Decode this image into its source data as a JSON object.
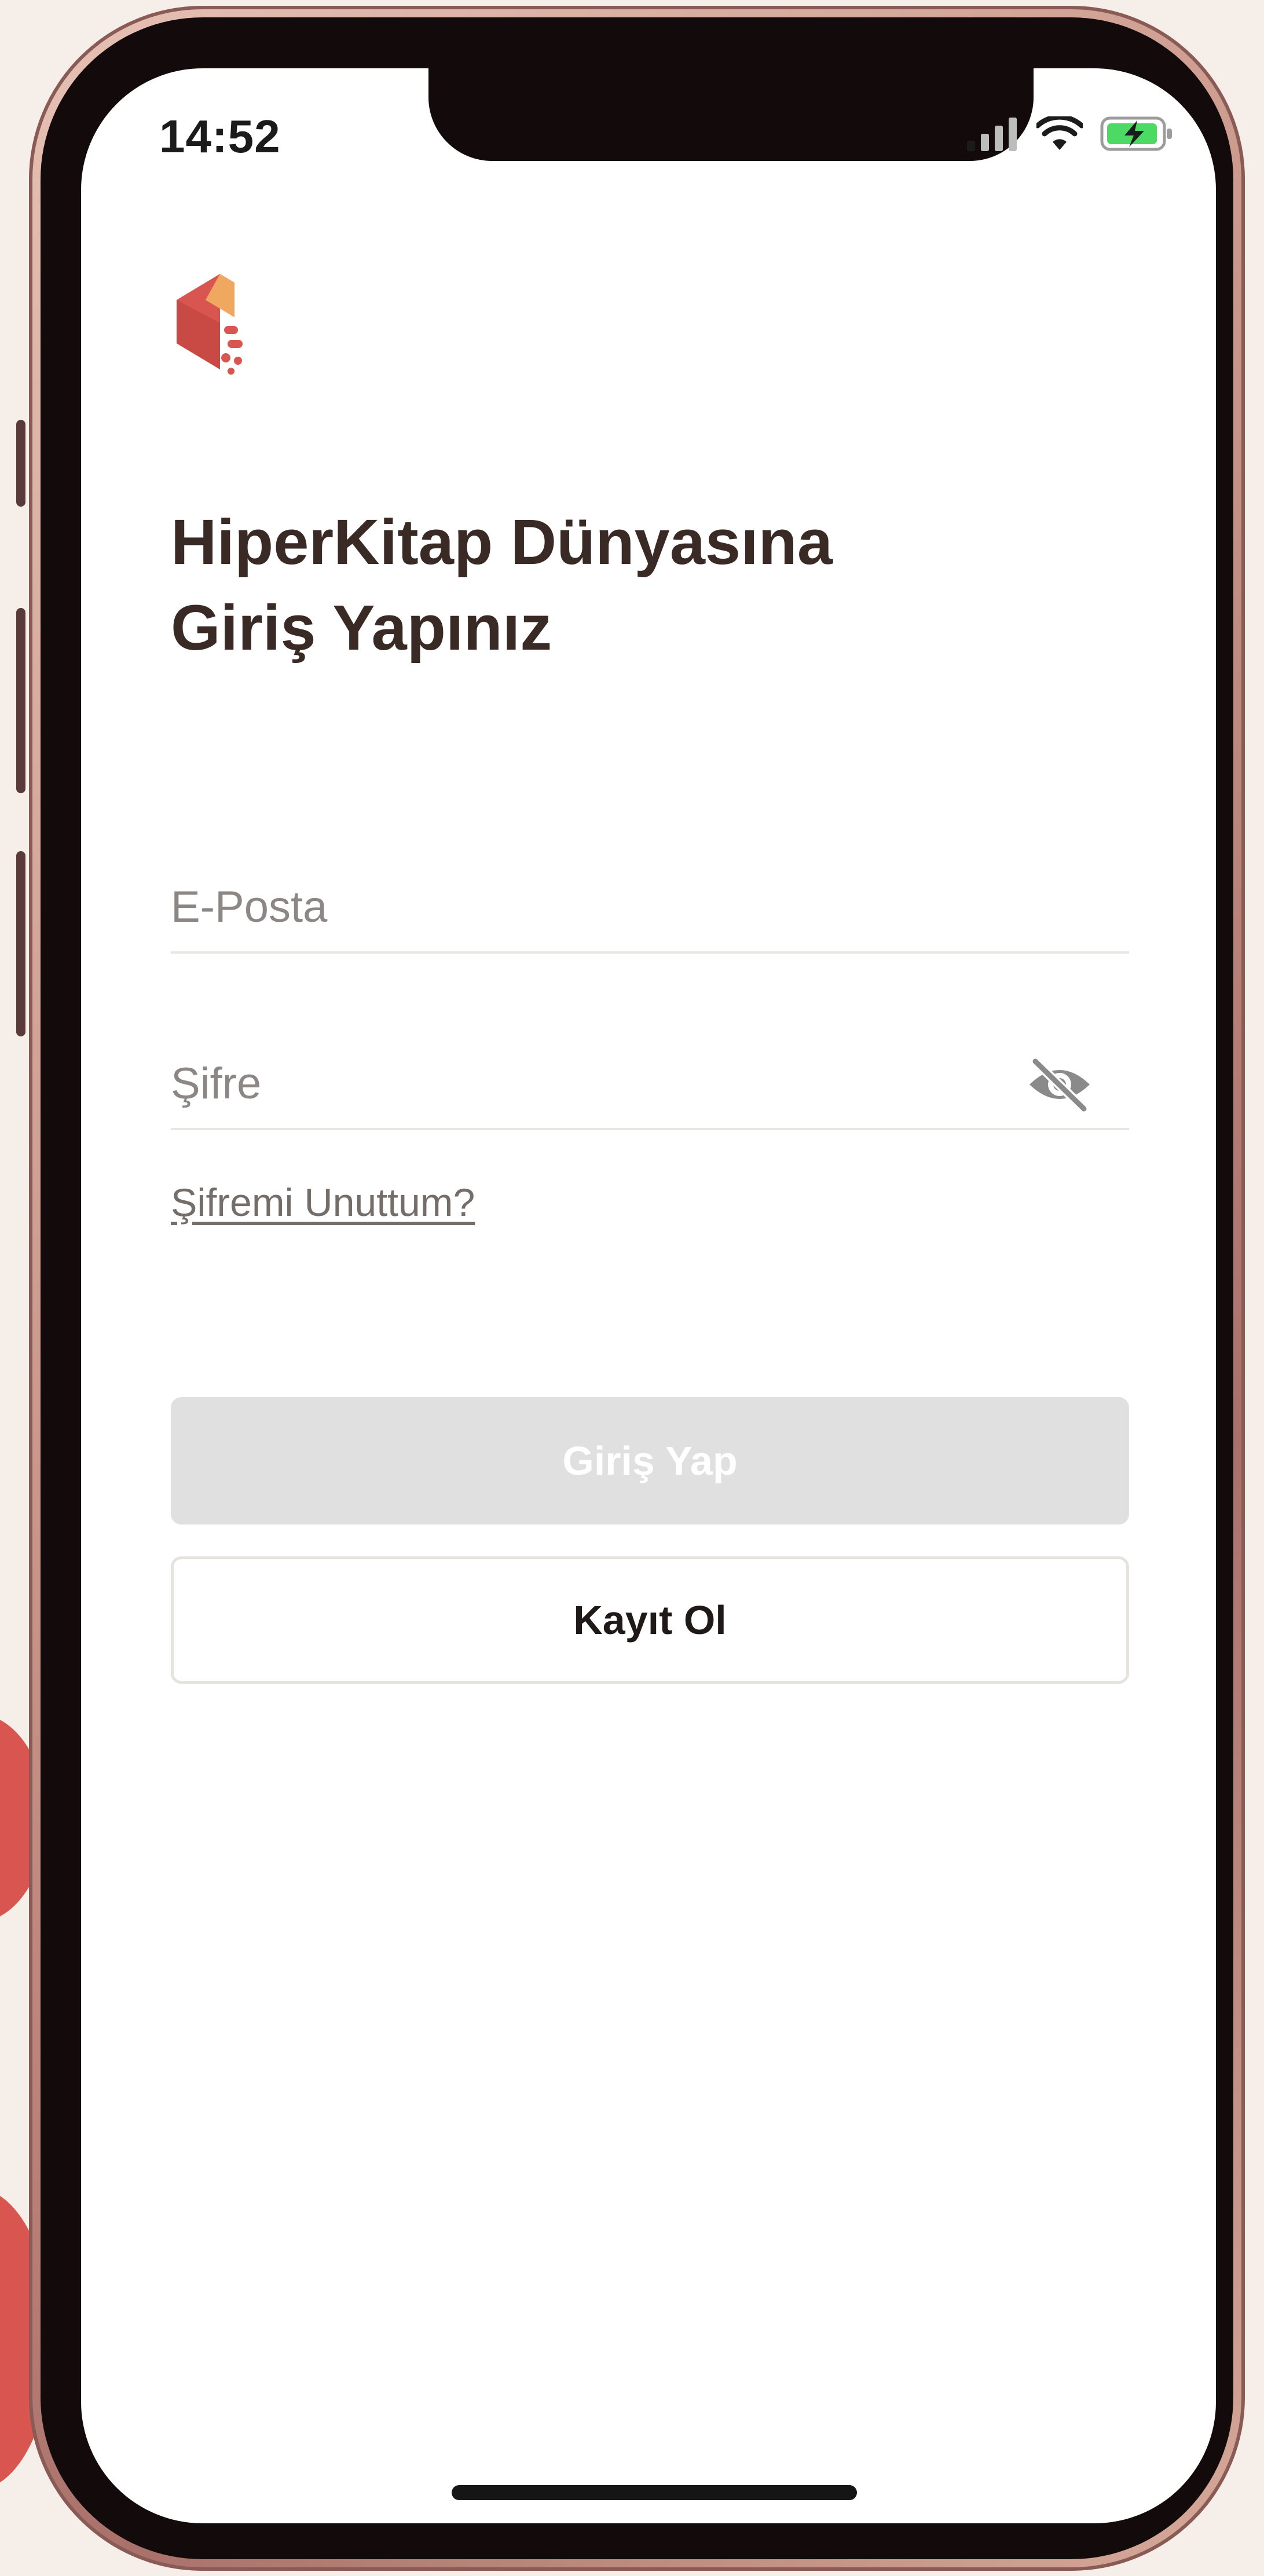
{
  "status_bar": {
    "time": "14:52",
    "icons": [
      "cellular-signal-icon",
      "wifi-icon",
      "battery-charging-icon"
    ]
  },
  "logo": {
    "icon": "hiperkitap-logo-icon"
  },
  "heading": {
    "line1": "HiperKitap Dünyasına",
    "line2": "Giriş Yapınız"
  },
  "form": {
    "email_placeholder": "E-Posta",
    "password_placeholder": "Şifre",
    "password_visibility_icon": "eye-slash-icon",
    "forgot_password": "Şifremi Unuttum?"
  },
  "buttons": {
    "login": "Giriş Yap",
    "register": "Kayıt Ol"
  },
  "colors": {
    "brand_red": "#d9554f",
    "brand_orange": "#f0a861",
    "heading_text": "#3a2a26",
    "disabled_button": "#e0e0e0"
  }
}
